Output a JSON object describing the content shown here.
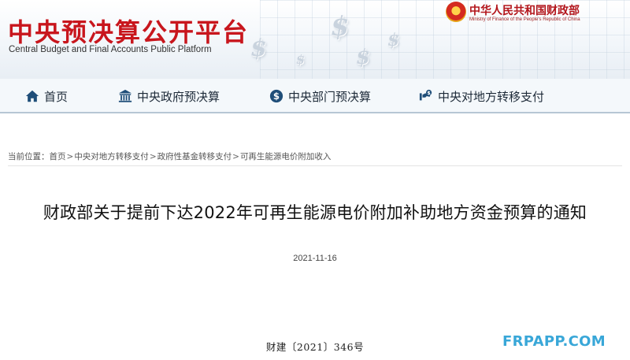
{
  "header": {
    "site_title": "中央预决算公开平台",
    "site_subtitle": "Central Budget and Final Accounts Public Platform",
    "ministry_cn": "中华人民共和国财政部",
    "ministry_en": "Ministry of Finance of the People's Republic of China",
    "accent_color": "#c8161d"
  },
  "nav": {
    "items": [
      {
        "label": "首页",
        "icon": "home-icon"
      },
      {
        "label": "中央政府预决算",
        "icon": "government-building-icon"
      },
      {
        "label": "中央部门预决算",
        "icon": "dollar-coin-icon"
      },
      {
        "label": "中央对地方转移支付",
        "icon": "transfer-payment-icon"
      }
    ]
  },
  "breadcrumb": {
    "prefix": "当前位置：",
    "items": [
      "首页",
      "中央对地方转移支付",
      "政府性基金转移支付",
      "可再生能源电价附加收入"
    ],
    "separator": ">"
  },
  "article": {
    "title": "财政部关于提前下达2022年可再生能源电价附加补助地方资金预算的通知",
    "date": "2021-11-16",
    "doc_number": "财建〔2021〕346号"
  },
  "watermark": "FRPAPP.COM"
}
